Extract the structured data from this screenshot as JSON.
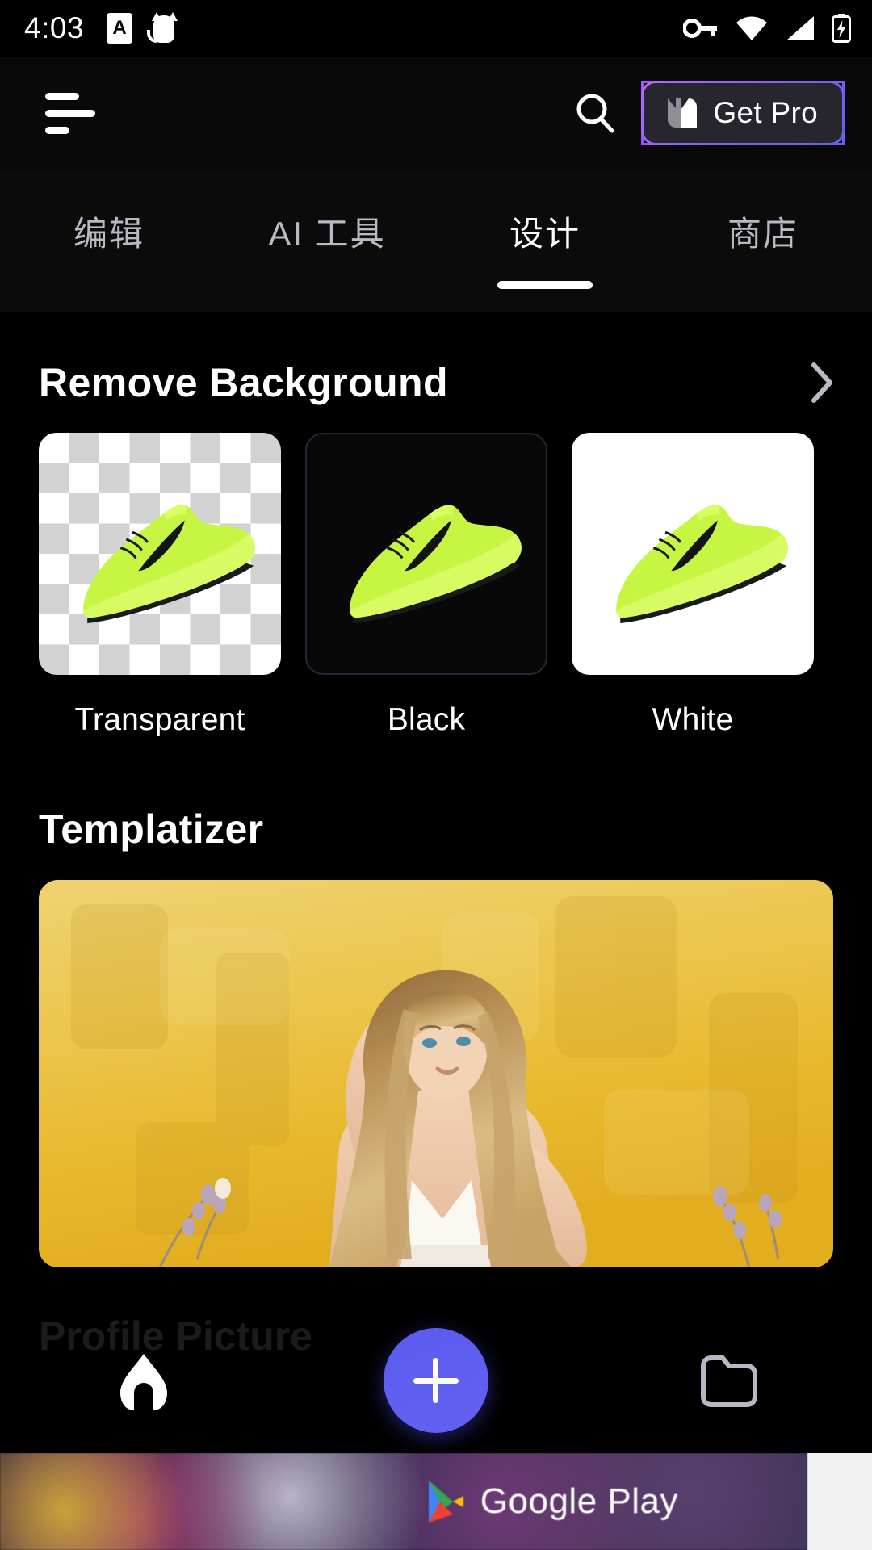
{
  "statusbar": {
    "time": "4:03",
    "left_icons": [
      "aa-notification-icon",
      "cat-notification-icon"
    ],
    "right_icons": [
      "vpn-key-icon",
      "wifi-icon",
      "cellular-signal-icon",
      "battery-charging-icon"
    ]
  },
  "appbar": {
    "menu_icon": "hamburger-menu-icon",
    "search_icon": "search-icon",
    "get_pro_label": "Get Pro",
    "get_pro_logo": "picsart-logo-icon",
    "accent_purple": "#8b5cf6",
    "pro_bg": "#27262e"
  },
  "tabs": [
    {
      "label": "编辑",
      "active": false
    },
    {
      "label": "AI 工具",
      "active": false
    },
    {
      "label": "设计",
      "active": true
    },
    {
      "label": "商店",
      "active": false
    }
  ],
  "sections": {
    "remove_background": {
      "title": "Remove Background",
      "chevron_icon": "chevron-right-icon",
      "items": [
        {
          "label": "Transparent",
          "style": "transparent"
        },
        {
          "label": "Black",
          "style": "black"
        },
        {
          "label": "White",
          "style": "white"
        }
      ]
    },
    "templatizer": {
      "title": "Templatizer",
      "card_alt": "woman-with-long-blonde-hair-yellow-wall"
    },
    "profile_picture": {
      "title": "Profile Picture"
    }
  },
  "bottomnav": {
    "items": [
      {
        "name": "home-icon",
        "active": true
      },
      {
        "name": "add-plus-icon",
        "active": false
      },
      {
        "name": "folder-icon",
        "active": false
      }
    ],
    "fab_color": "#5b5bf0"
  },
  "ad": {
    "store_label": "Google Play",
    "logo": "google-play-icon"
  }
}
